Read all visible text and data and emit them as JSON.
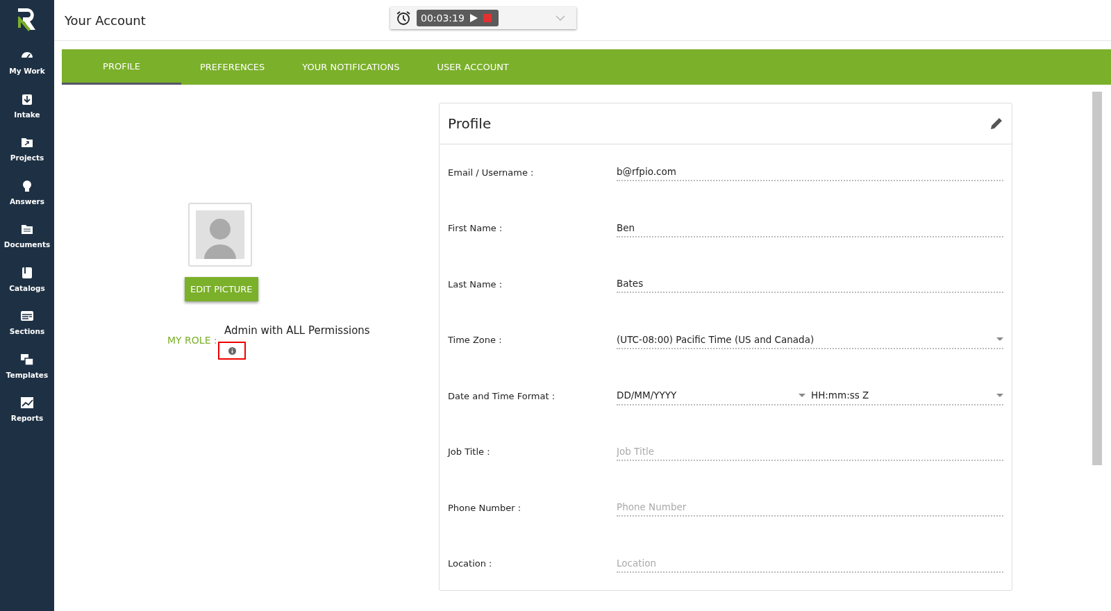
{
  "sidebar": {
    "items": [
      {
        "label": "My Work"
      },
      {
        "label": "Intake"
      },
      {
        "label": "Projects"
      },
      {
        "label": "Answers"
      },
      {
        "label": "Documents"
      },
      {
        "label": "Catalogs"
      },
      {
        "label": "Sections"
      },
      {
        "label": "Templates"
      },
      {
        "label": "Reports"
      }
    ]
  },
  "header": {
    "title": "Your Account",
    "timer": {
      "time": "00:03:19"
    }
  },
  "tabs": [
    {
      "label": "PROFILE",
      "selected": true
    },
    {
      "label": "PREFERENCES",
      "selected": false
    },
    {
      "label": "YOUR NOTIFICATIONS",
      "selected": false
    },
    {
      "label": "USER ACCOUNT",
      "selected": false
    }
  ],
  "picture": {
    "button": "EDIT PICTURE"
  },
  "role": {
    "label": "MY ROLE :",
    "value": "Admin with ALL Permissions",
    "info_highlighted": true
  },
  "profile": {
    "title": "Profile",
    "fields": [
      {
        "kind": "text",
        "label": "Email / Username :",
        "value": "b@rfpio.com"
      },
      {
        "kind": "text",
        "label": "First Name :",
        "value": "Ben"
      },
      {
        "kind": "text",
        "label": "Last Name :",
        "value": "Bates"
      },
      {
        "kind": "select",
        "label": "Time Zone :",
        "value": "(UTC-08:00) Pacific Time (US and Canada)"
      },
      {
        "kind": "dual-select",
        "label": "Date and Time Format :",
        "value": "DD/MM/YYYY",
        "value2": "HH:mm:ss Z"
      },
      {
        "kind": "text",
        "label": "Job Title :",
        "placeholder": "Job Title"
      },
      {
        "kind": "text",
        "label": "Phone Number :",
        "placeholder": "Phone Number"
      },
      {
        "kind": "text",
        "label": "Location :",
        "placeholder": "Location"
      }
    ]
  }
}
